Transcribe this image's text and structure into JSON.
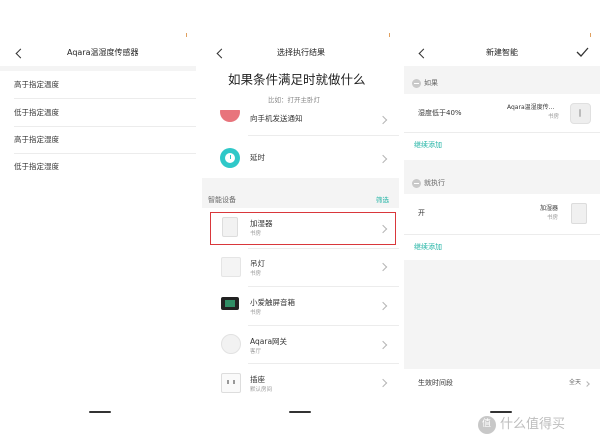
{
  "panel1": {
    "title": "Aqara温湿度传感器",
    "options": [
      "高于指定温度",
      "低于指定温度",
      "高于指定湿度",
      "低于指定湿度"
    ]
  },
  "panel2": {
    "title": "选择执行结果",
    "heading": "如果条件满足时就做什么",
    "subheading": "比如：打开主卧灯",
    "partial_item": "向手机发送通知",
    "delay_label": "延时",
    "section_label": "智能设备",
    "filter_label": "筛选",
    "devices": [
      {
        "name": "加湿器",
        "room": "书房"
      },
      {
        "name": "吊灯",
        "room": "书房"
      },
      {
        "name": "小爱触屏音箱",
        "room": "书房"
      },
      {
        "name": "Aqara网关",
        "room": "客厅"
      },
      {
        "name": "插座",
        "room": "默认房间"
      }
    ]
  },
  "panel3": {
    "title": "新建智能",
    "if_label": "如果",
    "condition_text": "湿度低于40%",
    "condition_device": "Aqara温湿度传...",
    "condition_room": "书房",
    "add_more_1": "继续添加",
    "then_label": "就执行",
    "action_text": "开",
    "action_device": "加湿器",
    "action_room": "书房",
    "add_more_2": "继续添加",
    "time_label": "生效时间段",
    "time_value": "全天"
  },
  "watermark": {
    "circle_char": "值",
    "text": "什么值得买"
  },
  "colors": {
    "accent": "#1fb3a4",
    "highlight_border": "#d9373b",
    "delay_icon": "#2fc8c8"
  }
}
